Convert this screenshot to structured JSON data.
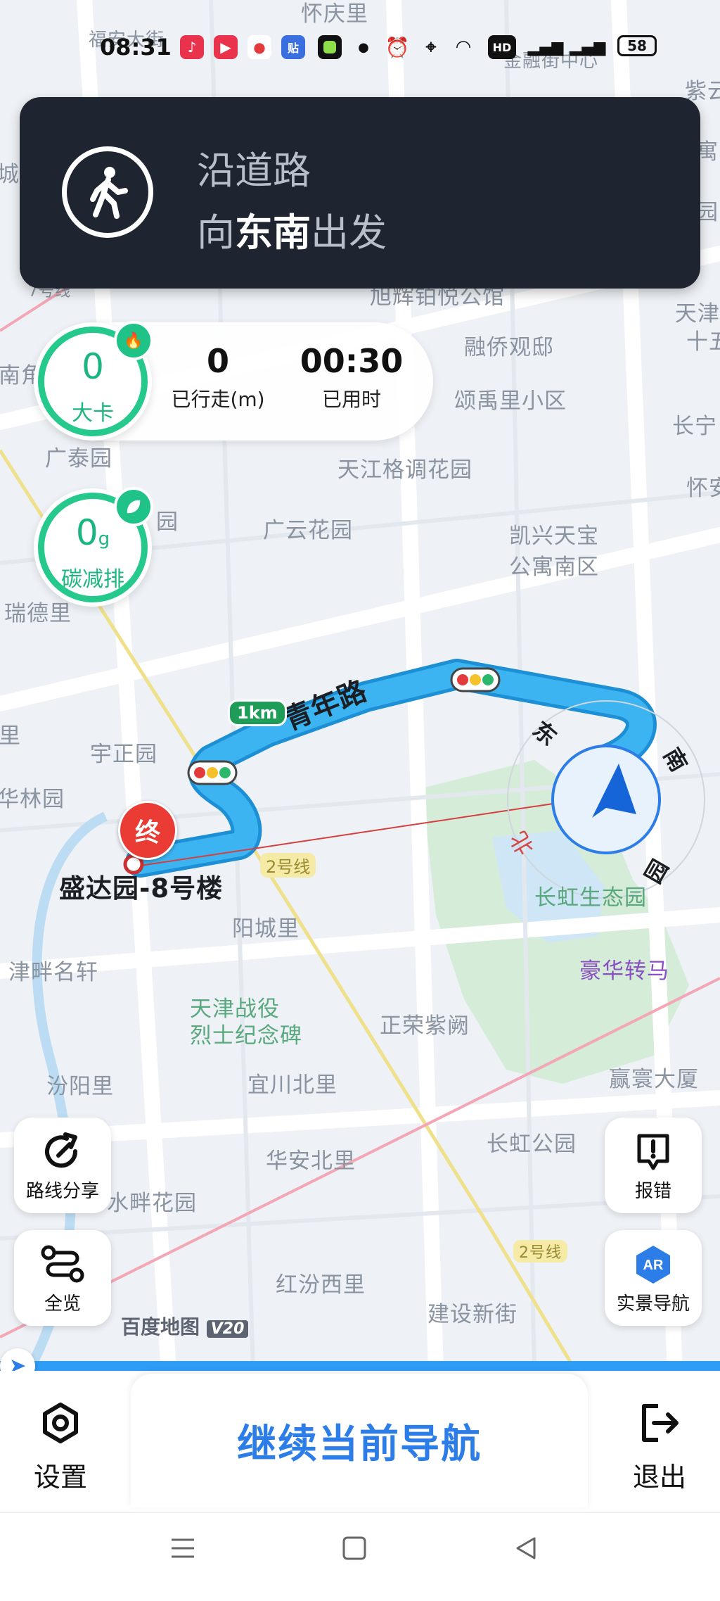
{
  "status_bar": {
    "time": "08:31",
    "battery": "58",
    "icons": [
      "music-app-icon",
      "video-app-icon",
      "map-pin-app-icon",
      "sticker-app-icon",
      "green-app-icon",
      "dot-icon",
      "alarm-icon",
      "location-icon",
      "wifi-icon",
      "hd-icon",
      "signal-icon",
      "signal-icon"
    ]
  },
  "guide": {
    "line1": "沿道路",
    "line2_prefix": "向",
    "line2_direction": "东南",
    "line2_suffix": "出发"
  },
  "stats": {
    "calories_value": "0",
    "calories_label": "大卡",
    "distance_value": "0",
    "distance_label": "已行走(m)",
    "time_value": "00:30",
    "time_label": "已用时",
    "carbon_value": "0",
    "carbon_unit": "g",
    "carbon_label": "碳减排"
  },
  "map": {
    "route_road": "青年路",
    "distance_tag": "1km",
    "destination_marker": "终",
    "destination_name": "盛达园-8号楼",
    "metro_line_label": "2号线",
    "watermark": "百度地图",
    "watermark_version": "V20",
    "compass": {
      "east": "东",
      "south": "南",
      "north": "北",
      "yuan": "园"
    },
    "labels": [
      "怀庆里",
      "福安大街",
      "金融街中心",
      "紫云",
      "城",
      "寓",
      "园",
      "7号线",
      "旭辉铂悦公馆",
      "天津",
      "十五",
      "南角",
      "融侨观邸",
      "颂禹里小区",
      "长宁",
      "广泰园",
      "天江格调花园",
      "怀安",
      "广云花园",
      "凯兴天宝",
      "公寓南区",
      "瑞德里",
      "园",
      "里",
      "宇正园",
      "华林园",
      "长虹生态园",
      "阳城里",
      "津畔名轩",
      "豪华转马",
      "天津战役",
      "烈士纪念碑",
      "正荣紫阙",
      "汾阳里",
      "宜川北里",
      "赢寰大厦",
      "长虹公园",
      "华安北里",
      "水畔花园",
      "红汾西里",
      "建设新街",
      "2号线"
    ]
  },
  "buttons": {
    "share_route": "路线分享",
    "overview": "全览",
    "report": "报错",
    "ar_nav": "实景导航",
    "settings": "设置",
    "continue": "继续当前导航",
    "exit": "退出"
  },
  "colors": {
    "route": "#2fa5ea",
    "accent_green": "#1bb57f",
    "continue_text": "#2d7de8",
    "card_bg": "#1f2530"
  }
}
